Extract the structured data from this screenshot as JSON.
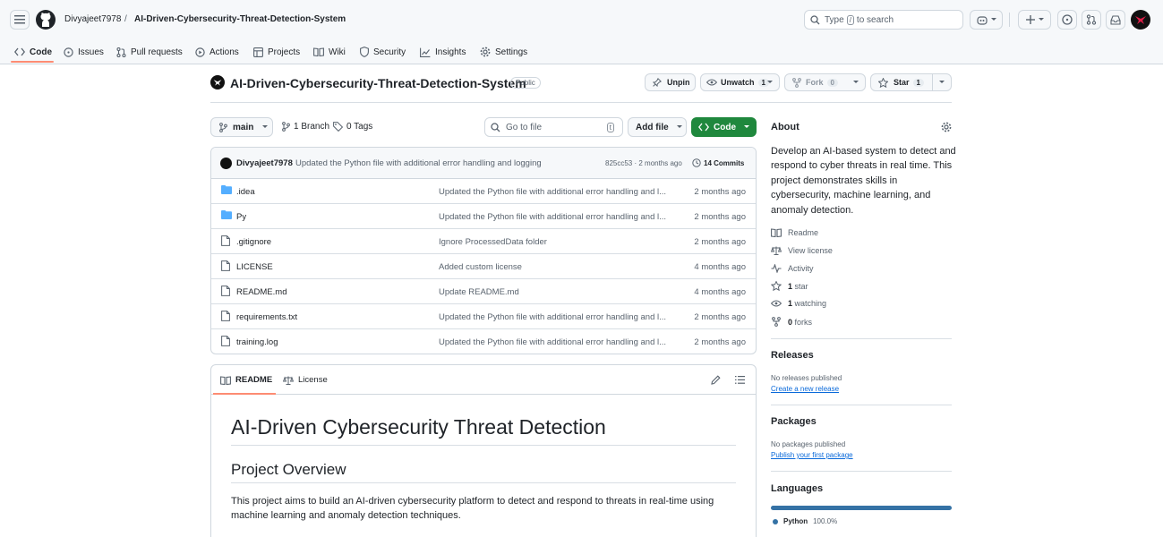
{
  "header": {
    "owner": "Divyajeet7978",
    "separator": "/",
    "repo": "AI-Driven-Cybersecurity-Threat-Detection-System",
    "search_prefix": "Type",
    "search_key": "/",
    "search_suffix": "to search"
  },
  "tabs": [
    {
      "label": "Code",
      "icon": "code-icon"
    },
    {
      "label": "Issues",
      "icon": "issue-icon"
    },
    {
      "label": "Pull requests",
      "icon": "pull-request-icon"
    },
    {
      "label": "Actions",
      "icon": "play-icon"
    },
    {
      "label": "Projects",
      "icon": "table-icon"
    },
    {
      "label": "Wiki",
      "icon": "book-icon"
    },
    {
      "label": "Security",
      "icon": "shield-icon"
    },
    {
      "label": "Insights",
      "icon": "graph-icon"
    },
    {
      "label": "Settings",
      "icon": "gear-icon"
    }
  ],
  "repo_header": {
    "title": "AI-Driven-Cybersecurity-Threat-Detection-System",
    "visibility": "Public",
    "unpin": "Unpin",
    "unwatch": "Unwatch",
    "watch_count": "1",
    "fork": "Fork",
    "fork_count": "0",
    "star": "Star",
    "star_count": "1"
  },
  "toolbar": {
    "branch": "main",
    "branches": "1 Branch",
    "tags": "0 Tags",
    "go_to_file": "Go to file",
    "go_to_file_key": "t",
    "add_file": "Add file",
    "code": "Code"
  },
  "latest_commit": {
    "author": "Divyajeet7978",
    "message": "Updated the Python file with additional error handling and logging",
    "meta": "825cc53 · 2 months ago",
    "commits": "14 Commits"
  },
  "files": [
    {
      "name": ".idea",
      "type": "folder",
      "message": "Updated the Python file with additional error handling and l...",
      "age": "2 months ago"
    },
    {
      "name": "Py",
      "type": "folder",
      "message": "Updated the Python file with additional error handling and l...",
      "age": "2 months ago"
    },
    {
      "name": ".gitignore",
      "type": "file",
      "message": "Ignore ProcessedData folder",
      "age": "2 months ago"
    },
    {
      "name": "LICENSE",
      "type": "file",
      "message": "Added custom license",
      "age": "4 months ago"
    },
    {
      "name": "README.md",
      "type": "file",
      "message": "Update README.md",
      "age": "4 months ago"
    },
    {
      "name": "requirements.txt",
      "type": "file",
      "message": "Updated the Python file with additional error handling and l...",
      "age": "2 months ago"
    },
    {
      "name": "training.log",
      "type": "file",
      "message": "Updated the Python file with additional error handling and l...",
      "age": "2 months ago"
    }
  ],
  "readme": {
    "tab_readme": "README",
    "tab_license": "License",
    "h1": "AI-Driven Cybersecurity Threat Detection",
    "h2": "Project Overview",
    "paragraph": "This project aims to build an AI-driven cybersecurity platform to detect and respond to threats in real-time using machine learning and anomaly detection techniques."
  },
  "about": {
    "heading": "About",
    "description": "Develop an AI-based system to detect and respond to cyber threats in real time. This project demonstrates skills in cybersecurity, machine learning, and anomaly detection.",
    "links": [
      {
        "label": "Readme",
        "icon": "book-icon"
      },
      {
        "label": "View license",
        "icon": "scale-icon"
      },
      {
        "label": "Activity",
        "icon": "pulse-icon"
      },
      {
        "bold": "1",
        "label": "star",
        "icon": "star-icon"
      },
      {
        "bold": "1",
        "label": "watching",
        "icon": "eye-icon"
      },
      {
        "bold": "0",
        "label": "forks",
        "icon": "fork-icon"
      }
    ]
  },
  "releases": {
    "heading": "Releases",
    "empty": "No releases published",
    "link": "Create a new release"
  },
  "packages": {
    "heading": "Packages",
    "empty": "No packages published",
    "link": "Publish your first package"
  },
  "languages": {
    "heading": "Languages",
    "items": [
      {
        "name": "Python",
        "percent": "100.0%",
        "color": "#3572a5"
      }
    ]
  },
  "colors": {
    "accent_tab": "#fd8c73",
    "primary_button": "#1f883d",
    "link": "#0969da",
    "folder": "#54aeff"
  }
}
